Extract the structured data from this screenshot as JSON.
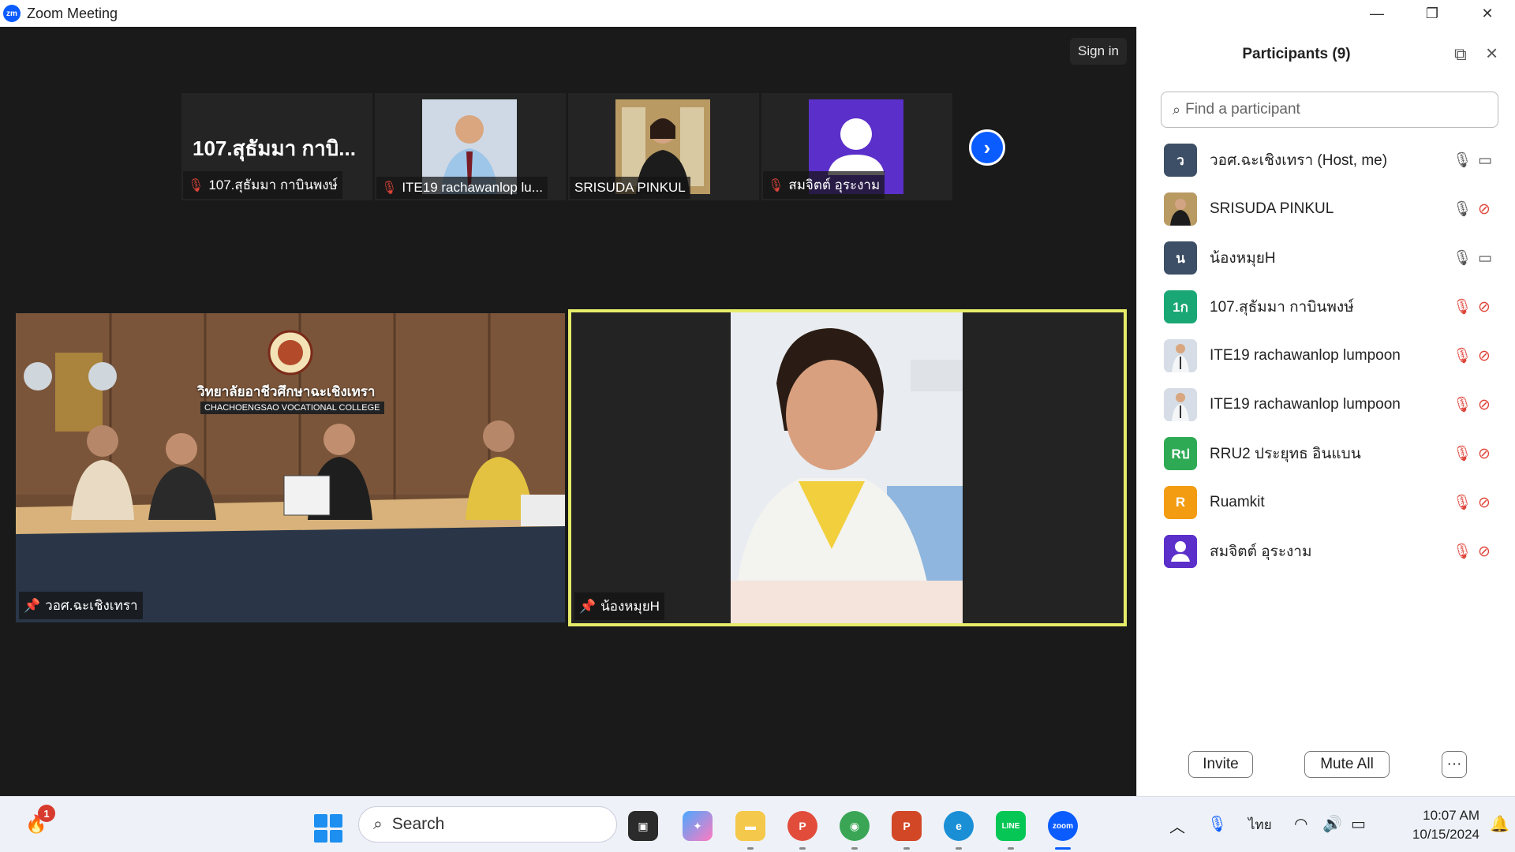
{
  "window": {
    "logo": "zm",
    "title": "Zoom Meeting",
    "controls": {
      "minimize": "—",
      "restore": "❐",
      "close": "✕"
    }
  },
  "meeting": {
    "sign_in": "Sign in",
    "thumbnails": [
      {
        "big_name": "107.สุธัมมา กาบิ...",
        "label": "107.สุธัมมา กาบินพงษ์",
        "muted": true
      },
      {
        "label": "ITE19 rachawanlop lu...",
        "muted": true
      },
      {
        "label": "SRISUDA PINKUL",
        "muted": false
      },
      {
        "label": "สมจิตต์ อุระงาม",
        "muted": true
      }
    ],
    "next_icon": "›",
    "tiles": [
      {
        "label": "วอศ.ฉะเชิงเทรา",
        "banner_th": "วิทยาลัยอาชีวศึกษาฉะเชิงเทรา",
        "banner_en": "CHACHOENGSAO VOCATIONAL COLLEGE"
      },
      {
        "label": "น้องหมุยH"
      }
    ]
  },
  "participants": {
    "title": "Participants (9)",
    "search_placeholder": "Find a participant",
    "items": [
      {
        "initial": "ว",
        "name": "วอศ.ฉะเชิงเทรา (Host, me)",
        "avatar_color": "#3d4f66",
        "mic_muted": false,
        "cam_off": false
      },
      {
        "initial": "",
        "name": "SRISUDA PINKUL",
        "avatar_color": "#8a6a3a",
        "mic_muted": false,
        "cam_off": true
      },
      {
        "initial": "น",
        "name": "น้องหมุยH",
        "avatar_color": "#3d4f66",
        "mic_muted": false,
        "cam_off": false
      },
      {
        "initial": "1ก",
        "name": "107.สุธัมมา กาบินพงษ์",
        "avatar_color": "#1aa776",
        "mic_muted": true,
        "cam_off": true
      },
      {
        "initial": "",
        "name": "ITE19 rachawanlop lumpoon",
        "avatar_color": "#c9ccd6",
        "mic_muted": true,
        "cam_off": true
      },
      {
        "initial": "",
        "name": "ITE19 rachawanlop lumpoon",
        "avatar_color": "#c9ccd6",
        "mic_muted": true,
        "cam_off": true
      },
      {
        "initial": "Rป",
        "name": "RRU2 ประยุทธ อินแบน",
        "avatar_color": "#2eaa55",
        "mic_muted": true,
        "cam_off": true
      },
      {
        "initial": "R",
        "name": "Ruamkit",
        "avatar_color": "#f39c12",
        "mic_muted": true,
        "cam_off": true
      },
      {
        "initial": "",
        "name": "สมจิตต์ อุระงาม",
        "avatar_color": "#5b2fc9",
        "mic_muted": true,
        "cam_off": true
      }
    ],
    "invite_label": "Invite",
    "mute_all_label": "Mute All",
    "more_label": "···"
  },
  "taskbar": {
    "notification_badge": "1",
    "search_label": "Search",
    "apps": [
      {
        "name": "file-explorer-app"
      },
      {
        "name": "copilot-app"
      },
      {
        "name": "folder-app"
      },
      {
        "name": "chrome-app-profile"
      },
      {
        "name": "chrome-app"
      },
      {
        "name": "powerpoint-app"
      },
      {
        "name": "edge-app"
      },
      {
        "name": "line-app"
      },
      {
        "name": "zoom-app"
      }
    ],
    "chrome_profile_badge": "P",
    "powerpoint_letter": "P",
    "line_label": "LINE",
    "zoom_label": "zoom",
    "language": "ไทย",
    "time": "10:07 AM",
    "date": "10/15/2024",
    "colors": {
      "accent": "#0b5cff",
      "muted_red": "#e0453a",
      "active_speaker": "#e6ec6a"
    }
  }
}
